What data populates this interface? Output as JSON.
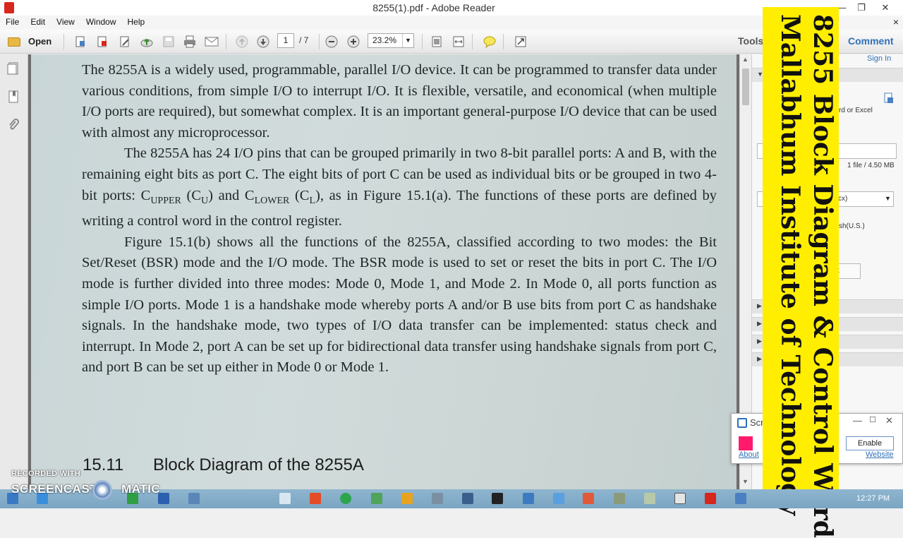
{
  "window": {
    "title": "8255(1).pdf - Adobe Reader",
    "minimize_glyph": "—",
    "restore_glyph": "❐",
    "close_glyph": "✕"
  },
  "menu": {
    "items": [
      "File",
      "Edit",
      "View",
      "Window",
      "Help"
    ],
    "close_glyph": "×"
  },
  "toolbar": {
    "open_label": "Open",
    "page_current": "1",
    "page_total": "/ 7",
    "zoom_value": "23.2%",
    "tools_label": "Tools",
    "comment_label": "Comment"
  },
  "right_pane": {
    "sign_in": "Sign In",
    "convert_text": "rd or Excel",
    "file_info": "1 file / 4.50 MB",
    "select_value": "cx)",
    "language": "sh(U.S.)",
    "button_label": "t"
  },
  "document": {
    "paragraphs": [
      "The 8255A is a widely used, programmable, parallel I/O device. It can be programmed to transfer data under various conditions, from simple I/O to interrupt I/O. It is flexible, versatile, and economical (when multiple I/O ports are required), but somewhat complex. It is an important general-purpose I/O device that can be used with almost any microprocessor.",
      "The 8255A has 24 I/O pins that can be grouped primarily in two 8-bit parallel ports: A and B, with the remaining eight bits as port C. The eight bits of port C can be used as individual bits or be grouped in two 4-bit ports: C",
      "Figure 15.1(b) shows all the functions of the 8255A, classified according to two modes: the Bit Set/Reset (BSR) mode and the I/O mode. The BSR mode is used to set or reset the bits in port C. The I/O mode is further divided into three modes: Mode 0, Mode 1, and Mode 2. In Mode 0, all ports function as simple I/O ports. Mode 1 is a handshake mode whereby ports A and/or B use bits from port C as handshake signals. In the handshake mode, two types of I/O data transfer can be implemented: status check and interrupt. In Mode 2, port A can be set up for bidirectional data transfer using handshake signals from port C, and port B can be set up either in Mode 0 or Mode 1."
    ],
    "p2_sub_upper": "UPPER",
    "p2_mid1": " (C",
    "p2_sub_u": "U",
    "p2_mid2": ") and C",
    "p2_sub_lower": "LOWER",
    "p2_mid3": " (C",
    "p2_sub_l": "L",
    "p2_tail": "), as in Figure 15.1(a). The functions of these ports are defined by writing a control word in the control register.",
    "section_number": "15.11",
    "section_title": "Block Diagram of the 8255A"
  },
  "banner": {
    "line1": "8255 Block Diagram & Control Word",
    "line2": "Mallabhum Institute of Technology",
    "color": "#ffee00"
  },
  "popup": {
    "title": "Scr",
    "about": "About",
    "enable": "Enable",
    "website": "Website",
    "swatch_color": "#ff1a6e"
  },
  "watermark": {
    "top": "RECORDED WITH",
    "left": "SCREENCAST",
    "right": "MATIC"
  },
  "taskbar": {
    "clock": "12:27 PM"
  }
}
